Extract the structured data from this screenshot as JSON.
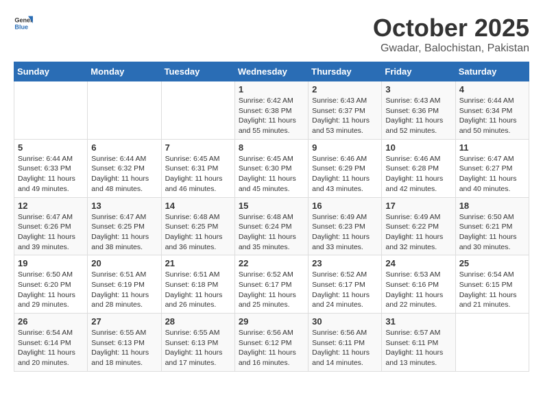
{
  "header": {
    "logo_general": "General",
    "logo_blue": "Blue",
    "month_year": "October 2025",
    "location": "Gwadar, Balochistan, Pakistan"
  },
  "weekdays": [
    "Sunday",
    "Monday",
    "Tuesday",
    "Wednesday",
    "Thursday",
    "Friday",
    "Saturday"
  ],
  "weeks": [
    [
      {
        "day": "",
        "info": ""
      },
      {
        "day": "",
        "info": ""
      },
      {
        "day": "",
        "info": ""
      },
      {
        "day": "1",
        "info": "Sunrise: 6:42 AM\nSunset: 6:38 PM\nDaylight: 11 hours and 55 minutes."
      },
      {
        "day": "2",
        "info": "Sunrise: 6:43 AM\nSunset: 6:37 PM\nDaylight: 11 hours and 53 minutes."
      },
      {
        "day": "3",
        "info": "Sunrise: 6:43 AM\nSunset: 6:36 PM\nDaylight: 11 hours and 52 minutes."
      },
      {
        "day": "4",
        "info": "Sunrise: 6:44 AM\nSunset: 6:34 PM\nDaylight: 11 hours and 50 minutes."
      }
    ],
    [
      {
        "day": "5",
        "info": "Sunrise: 6:44 AM\nSunset: 6:33 PM\nDaylight: 11 hours and 49 minutes."
      },
      {
        "day": "6",
        "info": "Sunrise: 6:44 AM\nSunset: 6:32 PM\nDaylight: 11 hours and 48 minutes."
      },
      {
        "day": "7",
        "info": "Sunrise: 6:45 AM\nSunset: 6:31 PM\nDaylight: 11 hours and 46 minutes."
      },
      {
        "day": "8",
        "info": "Sunrise: 6:45 AM\nSunset: 6:30 PM\nDaylight: 11 hours and 45 minutes."
      },
      {
        "day": "9",
        "info": "Sunrise: 6:46 AM\nSunset: 6:29 PM\nDaylight: 11 hours and 43 minutes."
      },
      {
        "day": "10",
        "info": "Sunrise: 6:46 AM\nSunset: 6:28 PM\nDaylight: 11 hours and 42 minutes."
      },
      {
        "day": "11",
        "info": "Sunrise: 6:47 AM\nSunset: 6:27 PM\nDaylight: 11 hours and 40 minutes."
      }
    ],
    [
      {
        "day": "12",
        "info": "Sunrise: 6:47 AM\nSunset: 6:26 PM\nDaylight: 11 hours and 39 minutes."
      },
      {
        "day": "13",
        "info": "Sunrise: 6:47 AM\nSunset: 6:25 PM\nDaylight: 11 hours and 38 minutes."
      },
      {
        "day": "14",
        "info": "Sunrise: 6:48 AM\nSunset: 6:25 PM\nDaylight: 11 hours and 36 minutes."
      },
      {
        "day": "15",
        "info": "Sunrise: 6:48 AM\nSunset: 6:24 PM\nDaylight: 11 hours and 35 minutes."
      },
      {
        "day": "16",
        "info": "Sunrise: 6:49 AM\nSunset: 6:23 PM\nDaylight: 11 hours and 33 minutes."
      },
      {
        "day": "17",
        "info": "Sunrise: 6:49 AM\nSunset: 6:22 PM\nDaylight: 11 hours and 32 minutes."
      },
      {
        "day": "18",
        "info": "Sunrise: 6:50 AM\nSunset: 6:21 PM\nDaylight: 11 hours and 30 minutes."
      }
    ],
    [
      {
        "day": "19",
        "info": "Sunrise: 6:50 AM\nSunset: 6:20 PM\nDaylight: 11 hours and 29 minutes."
      },
      {
        "day": "20",
        "info": "Sunrise: 6:51 AM\nSunset: 6:19 PM\nDaylight: 11 hours and 28 minutes."
      },
      {
        "day": "21",
        "info": "Sunrise: 6:51 AM\nSunset: 6:18 PM\nDaylight: 11 hours and 26 minutes."
      },
      {
        "day": "22",
        "info": "Sunrise: 6:52 AM\nSunset: 6:17 PM\nDaylight: 11 hours and 25 minutes."
      },
      {
        "day": "23",
        "info": "Sunrise: 6:52 AM\nSunset: 6:17 PM\nDaylight: 11 hours and 24 minutes."
      },
      {
        "day": "24",
        "info": "Sunrise: 6:53 AM\nSunset: 6:16 PM\nDaylight: 11 hours and 22 minutes."
      },
      {
        "day": "25",
        "info": "Sunrise: 6:54 AM\nSunset: 6:15 PM\nDaylight: 11 hours and 21 minutes."
      }
    ],
    [
      {
        "day": "26",
        "info": "Sunrise: 6:54 AM\nSunset: 6:14 PM\nDaylight: 11 hours and 20 minutes."
      },
      {
        "day": "27",
        "info": "Sunrise: 6:55 AM\nSunset: 6:13 PM\nDaylight: 11 hours and 18 minutes."
      },
      {
        "day": "28",
        "info": "Sunrise: 6:55 AM\nSunset: 6:13 PM\nDaylight: 11 hours and 17 minutes."
      },
      {
        "day": "29",
        "info": "Sunrise: 6:56 AM\nSunset: 6:12 PM\nDaylight: 11 hours and 16 minutes."
      },
      {
        "day": "30",
        "info": "Sunrise: 6:56 AM\nSunset: 6:11 PM\nDaylight: 11 hours and 14 minutes."
      },
      {
        "day": "31",
        "info": "Sunrise: 6:57 AM\nSunset: 6:11 PM\nDaylight: 11 hours and 13 minutes."
      },
      {
        "day": "",
        "info": ""
      }
    ]
  ]
}
